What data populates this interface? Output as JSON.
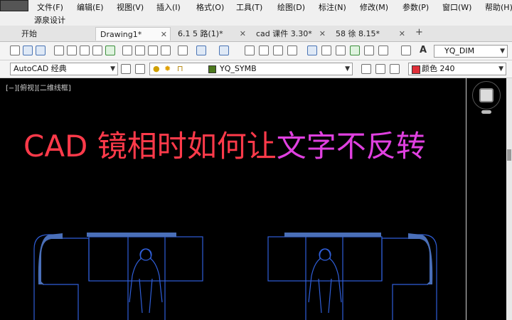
{
  "menu": {
    "items": [
      "文件(F)",
      "编辑(E)",
      "视图(V)",
      "插入(I)",
      "格式(O)",
      "工具(T)",
      "绘图(D)",
      "标注(N)",
      "修改(M)",
      "参数(P)",
      "窗口(W)",
      "帮助(H)"
    ],
    "sub_item": "源泉设计"
  },
  "tabs": [
    {
      "label": "开始",
      "active": false,
      "closable": false
    },
    {
      "label": "Drawing1*",
      "active": true,
      "closable": true
    },
    {
      "label": "6.1  5 路(1)*",
      "active": false,
      "closable": true
    },
    {
      "label": "cad  课件 3.30*",
      "active": false,
      "closable": true
    },
    {
      "label": "58 徐  8.15*",
      "active": false,
      "closable": true
    }
  ],
  "tab_add": "+",
  "toolbar1": {
    "dim_style": "YQ_DIM",
    "text_style_glyph": "A"
  },
  "toolbar2": {
    "workspace": "AutoCAD 经典",
    "layer": "YQ_SYMB",
    "color_label": "颜色 240",
    "color_hex": "#e0303a",
    "layer_color_hex": "#4d7a1e"
  },
  "viewport": {
    "label": "[−][俯视][二维线框]"
  },
  "headline": {
    "part1": "CAD 镜相时如何让",
    "part2": "文字不反转",
    "color1": "#ff3a4a",
    "color2": "#e040e0"
  },
  "drawing_colors": {
    "furniture": "#2f5ed8",
    "cushion": "#4a6fb8",
    "background": "#000000"
  }
}
